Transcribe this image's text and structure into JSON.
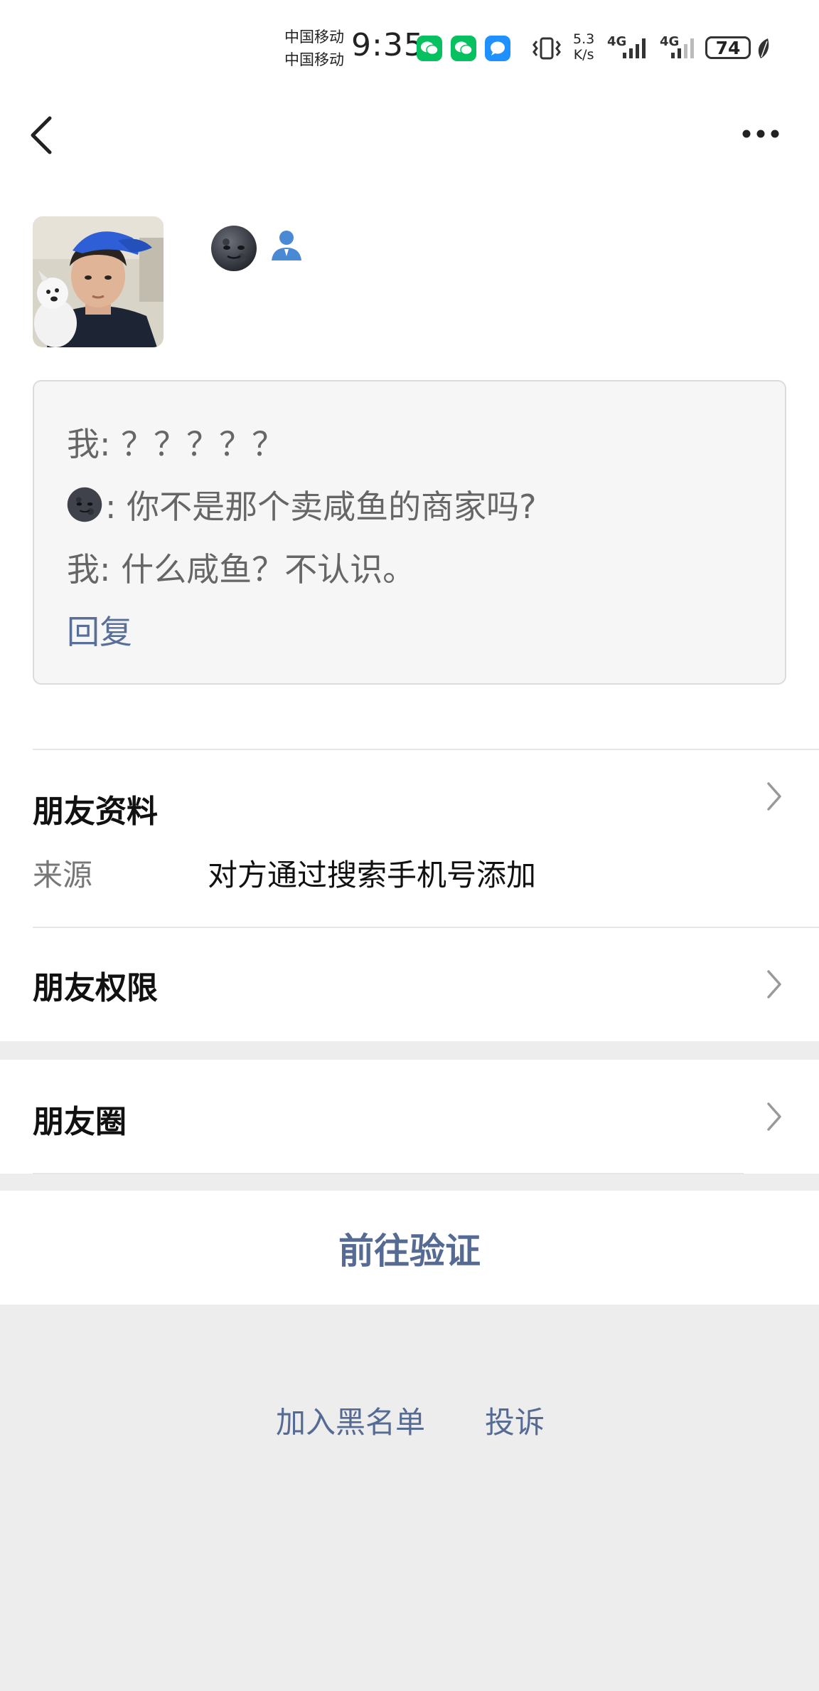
{
  "status_bar": {
    "carrier_1": "中国移动",
    "carrier_2": "中国移动",
    "time": "9:35",
    "speed_value": "5.3",
    "speed_unit": "K/s",
    "net_1": "4G",
    "net_2": "4G",
    "battery": "74",
    "icons": [
      "wechat-icon",
      "wechat-icon",
      "message-icon",
      "vibrate-icon",
      "signal-icon",
      "signal-icon",
      "battery-icon",
      "leaf-icon"
    ]
  },
  "nav": {
    "back_icon": "chevron-left-icon",
    "more_icon": "more-horizontal-icon"
  },
  "profile": {
    "nickname_icon": "new-moon-face-emoji",
    "contact_icon": "person-icon"
  },
  "messages": {
    "line1": "我: ？？？？？",
    "line2_text": ": 你不是那个卖咸鱼的商家吗?",
    "line3": "我: 什么咸鱼？不认识。",
    "reply": "回复"
  },
  "friend_info": {
    "title": "朋友资料",
    "source_label": "来源",
    "source_value": "对方通过搜索手机号添加"
  },
  "permissions": {
    "title": "朋友权限"
  },
  "moments": {
    "title": "朋友圈"
  },
  "verify": {
    "label": "前往验证"
  },
  "footer": {
    "blacklist": "加入黑名单",
    "report": "投诉"
  },
  "colors": {
    "link_blue": "#566b94",
    "wechat_green": "#07c160",
    "background": "#ededed"
  }
}
